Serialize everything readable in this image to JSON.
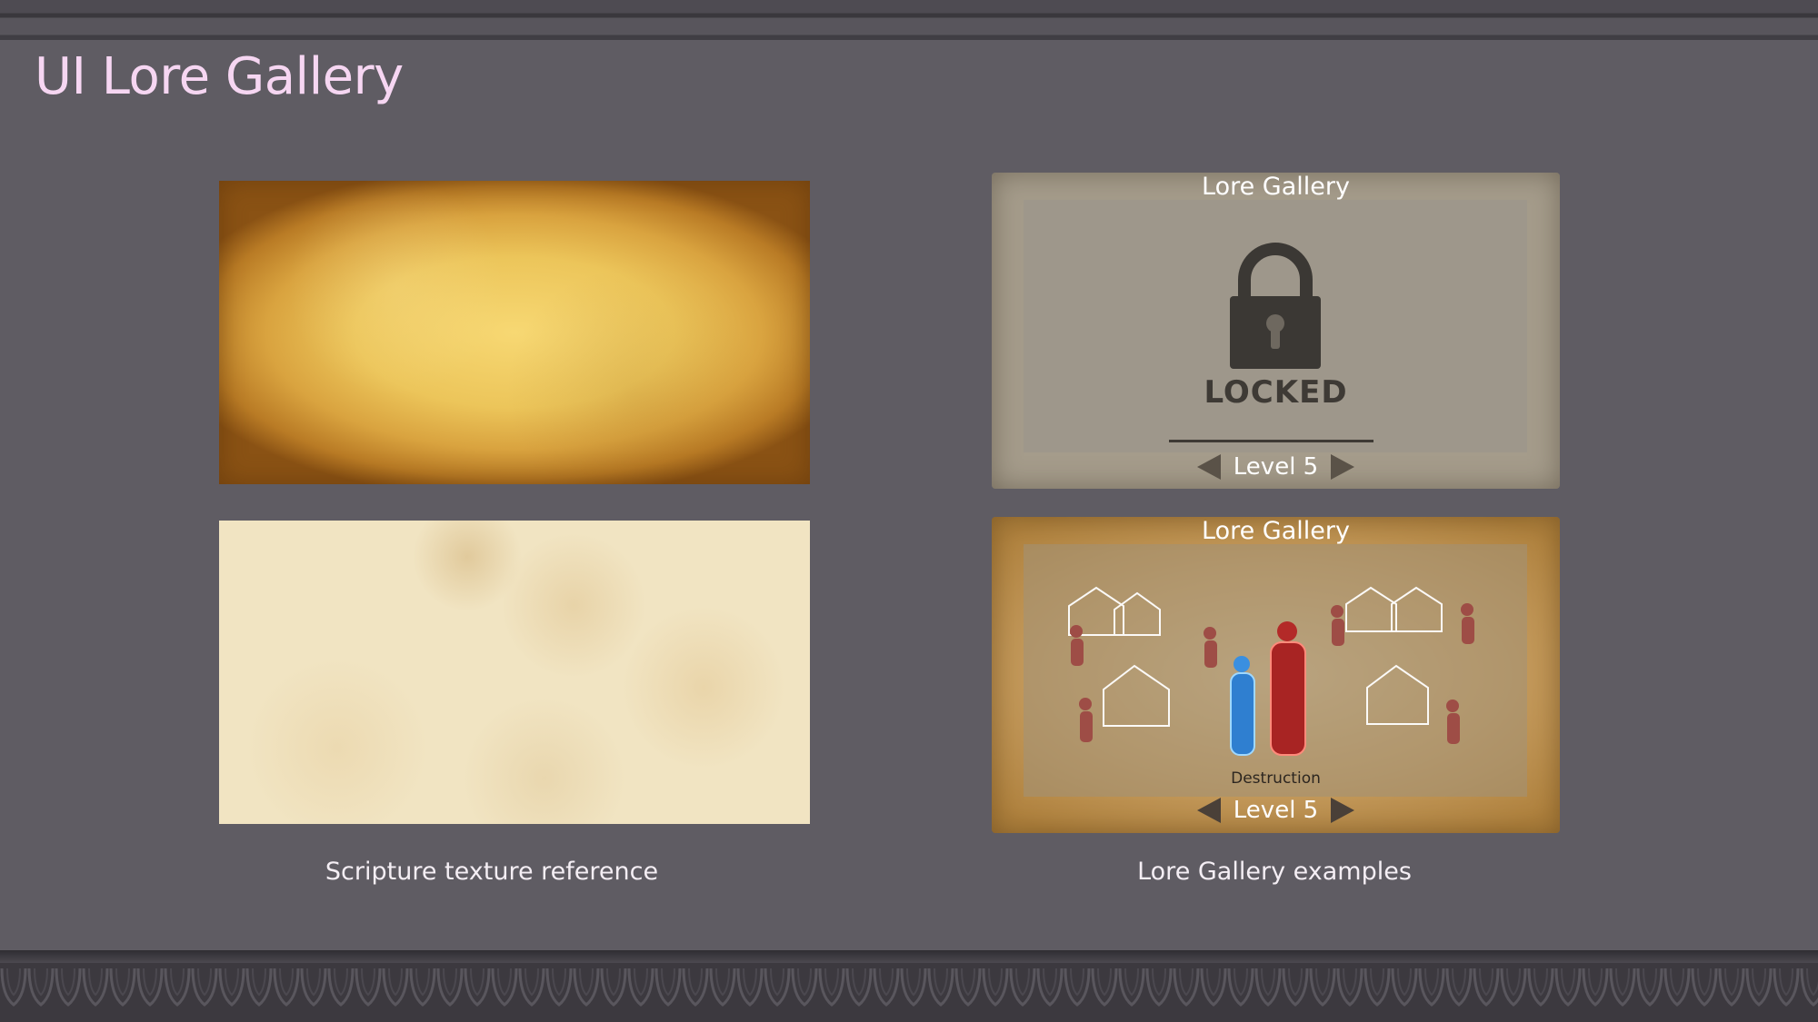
{
  "page": {
    "title": "UI Lore Gallery"
  },
  "references": {
    "caption": "Scripture texture reference",
    "textures": [
      {
        "name": "gold-aged-paper"
      },
      {
        "name": "cream-parchment"
      }
    ]
  },
  "examples": {
    "caption": "Lore Gallery examples",
    "locked_card": {
      "title": "Lore Gallery",
      "status": "LOCKED",
      "icon": "padlock-icon",
      "level": "Level 5"
    },
    "unlocked_card": {
      "title": "Lore Gallery",
      "image_caption": "Destruction",
      "level": "Level 5"
    }
  },
  "colors": {
    "background": "#5f5c63",
    "title": "#f6d6f2",
    "caption": "#f4eef4"
  }
}
